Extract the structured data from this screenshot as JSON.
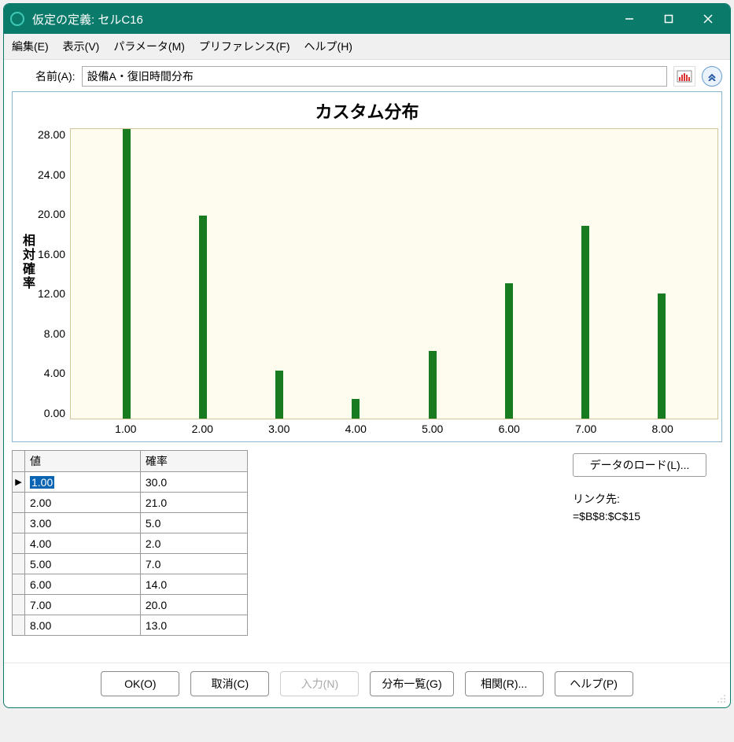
{
  "window": {
    "title": "仮定の定義: セルC16"
  },
  "menu": {
    "edit": "編集(E)",
    "view": "表示(V)",
    "params": "パラメータ(M)",
    "prefs": "プリファレンス(F)",
    "help": "ヘルプ(H)"
  },
  "name_row": {
    "label": "名前(A):",
    "value": "設備A・復旧時間分布"
  },
  "chart_data": {
    "type": "bar",
    "title": "カスタム分布",
    "ylabel": "相対確率",
    "categories": [
      "1.00",
      "2.00",
      "3.00",
      "4.00",
      "5.00",
      "6.00",
      "7.00",
      "8.00"
    ],
    "values": [
      30.0,
      21.0,
      5.0,
      2.0,
      7.0,
      14.0,
      20.0,
      13.0
    ],
    "yticks": [
      "28.00",
      "24.00",
      "20.00",
      "16.00",
      "12.00",
      "8.00",
      "4.00",
      "0.00"
    ],
    "ylim": [
      0,
      30
    ]
  },
  "table": {
    "headers": {
      "value": "値",
      "prob": "確率"
    },
    "rows": [
      {
        "value": "1.00",
        "prob": "30.0",
        "selected": true
      },
      {
        "value": "2.00",
        "prob": "21.0"
      },
      {
        "value": "3.00",
        "prob": "5.0"
      },
      {
        "value": "4.00",
        "prob": "2.0"
      },
      {
        "value": "5.00",
        "prob": "7.0"
      },
      {
        "value": "6.00",
        "prob": "14.0"
      },
      {
        "value": "7.00",
        "prob": "20.0"
      },
      {
        "value": "8.00",
        "prob": "13.0"
      }
    ]
  },
  "right_panel": {
    "load_data": "データのロード(L)...",
    "link_label": "リンク先:",
    "link_ref": "=$B$8:$C$15"
  },
  "footer": {
    "ok": "OK(O)",
    "cancel": "取消(C)",
    "enter": "入力(N)",
    "gallery": "分布一覧(G)",
    "corr": "相関(R)...",
    "help": "ヘルプ(P)"
  }
}
